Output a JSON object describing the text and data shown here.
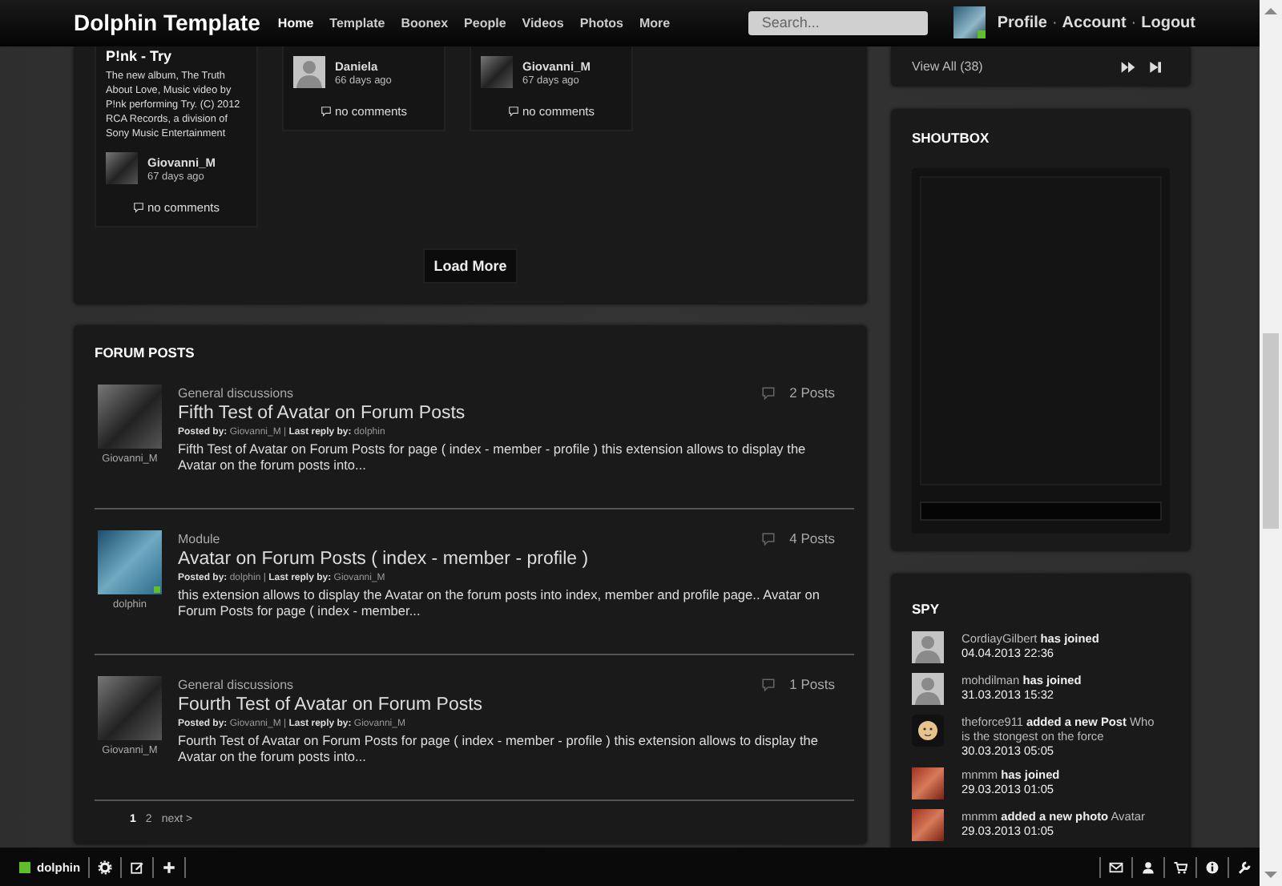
{
  "header": {
    "logo": "Dolphin Template",
    "nav": [
      {
        "label": "Home",
        "selected": true
      },
      {
        "label": "Template",
        "selected": false
      },
      {
        "label": "Boonex",
        "selected": false
      },
      {
        "label": "People",
        "selected": false
      },
      {
        "label": "Videos",
        "selected": false
      },
      {
        "label": "Photos",
        "selected": false
      },
      {
        "label": "More",
        "selected": false
      }
    ],
    "search": {
      "placeholder": "Search..."
    },
    "user": {
      "online": true,
      "links": [
        "Profile",
        "Account",
        "Logout"
      ],
      "separator": "·"
    }
  },
  "feed": {
    "cards": [
      {
        "title": "P!nk - Try",
        "description": "The new album, The Truth About Love, Music video by P!nk performing Try. (C) 2012 RCA Records, a division of Sony Music Entertainment",
        "author": "Giovanni_M",
        "time": "67 days ago",
        "avatar": {
          "kind": "photo"
        },
        "comments": "no comments"
      },
      {
        "author": "Daniela",
        "time": "66 days ago",
        "avatar": {
          "kind": "silhouette"
        },
        "comments": "no comments"
      },
      {
        "author": "Giovanni_M",
        "time": "67 days ago",
        "avatar": {
          "kind": "photo"
        },
        "comments": "no comments"
      }
    ],
    "load_more": "Load More"
  },
  "forum": {
    "title": "FORUM POSTS",
    "posts": [
      {
        "author": "Giovanni_M",
        "avatar": {
          "kind": "photo"
        },
        "online": false,
        "category": "General discussions",
        "title": "Fifth Test of Avatar on Forum Posts",
        "byline": "**Posted by:** Giovanni_M | **Last reply by:** dolphin",
        "excerpt": "Fifth Test of Avatar on Forum Posts for page ( index - member - profile ) this extension allows to display the Avatar on the forum posts into...",
        "count": "2 Posts"
      },
      {
        "author": "dolphin",
        "avatar": {
          "kind": "photo-blue"
        },
        "online": true,
        "category": "Module",
        "title": "Avatar on Forum Posts ( index - member - profile )",
        "byline": "**Posted by:** dolphin | **Last reply by:** Giovanni_M",
        "excerpt": "this extension allows to display the Avatar on the forum posts into index, member and profile page.. Avatar on Forum Posts for page ( index - member...",
        "count": "4 Posts"
      },
      {
        "author": "Giovanni_M",
        "avatar": {
          "kind": "photo"
        },
        "online": false,
        "category": "General discussions",
        "title": "Fourth Test of Avatar on Forum Posts",
        "byline": "**Posted by:** Giovanni_M | **Last reply by:** Giovanni_M",
        "excerpt": "Fourth Test of Avatar on Forum Posts for page ( index - member - profile ) this extension allows to display the Avatar on the forum posts into...",
        "count": "1 Posts"
      }
    ],
    "pagination": [
      {
        "label": "1",
        "selected": true
      },
      {
        "label": "2",
        "selected": false
      },
      {
        "label": "next >",
        "selected": false
      }
    ]
  },
  "sidebar": {
    "view_all": "View All (38)",
    "shoutbox": {
      "title": "SHOUTBOX"
    },
    "spy": {
      "title": "SPY",
      "items": [
        {
          "avatar": {
            "kind": "silhouette"
          },
          "text": "CordiayGilbert **has joined**",
          "time": "04.04.2013 22:36"
        },
        {
          "avatar": {
            "kind": "silhouette"
          },
          "text": "mohdilman **has joined**",
          "time": "31.03.2013 15:32"
        },
        {
          "avatar": {
            "kind": "cartoon"
          },
          "text": "theforce911 **added a new Post** Who is the stongest on the force",
          "time": "30.03.2013 05:05"
        },
        {
          "avatar": {
            "kind": "photo-red"
          },
          "text": "mnmm **has joined**",
          "time": "29.03.2013 01:05"
        },
        {
          "avatar": {
            "kind": "photo-red"
          },
          "text": "mnmm **added a new photo** Avatar",
          "time": "29.03.2013 01:05"
        }
      ]
    }
  },
  "toolbar": {
    "user": "dolphin",
    "online": true
  }
}
